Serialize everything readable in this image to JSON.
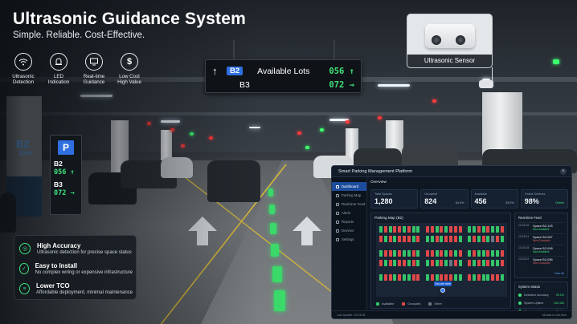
{
  "header": {
    "title": "Ultrasonic Guidance System",
    "subtitle": "Simple. Reliable. Cost-Effective."
  },
  "features": [
    {
      "icon": "wifi-icon",
      "label": "Ultrasonic\nDetection"
    },
    {
      "icon": "bell-icon",
      "label": "LED\nIndication"
    },
    {
      "icon": "monitor-icon",
      "label": "Real-time\nGuidance"
    },
    {
      "icon": "dollar-icon",
      "label": "Low Cost\nHigh Value"
    }
  ],
  "hanging_sign": {
    "row1": {
      "arrow": "↑",
      "badge": "B2",
      "label": "Available Lots",
      "value": "056 ↑"
    },
    "row2": {
      "level": "B3",
      "value": "072 →"
    }
  },
  "sensor": {
    "label": "Ultrasonic Sensor"
  },
  "zone": {
    "code": "B2",
    "sub": "ZONE"
  },
  "pillar_sign": {
    "badge": "P",
    "rows": [
      {
        "level": "B2",
        "value": "056 ↑"
      },
      {
        "level": "B3",
        "value": "072 →"
      }
    ]
  },
  "benefits": [
    {
      "icon": "target-icon",
      "title": "High Accuracy",
      "desc": "Ultrasonic detection for precise space status"
    },
    {
      "icon": "shield-check-icon",
      "title": "Easy to Install",
      "desc": "No complex wiring or expensive infrastructure"
    },
    {
      "icon": "database-icon",
      "title": "Lower TCO",
      "desc": "Affordable deployment, minimal maintenance"
    }
  ],
  "platform": {
    "title": "Smart Parking Management Platform",
    "nav": [
      "Dashboard",
      "Parking Map",
      "Real-time Feed",
      "Alerts",
      "Reports",
      "Devices",
      "Settings"
    ],
    "overview_label": "Overview",
    "cards": [
      {
        "label": "Total Spaces",
        "value": "1,280",
        "pct": ""
      },
      {
        "label": "Occupied",
        "value": "824",
        "pct": "64.4%"
      },
      {
        "label": "Available",
        "value": "456",
        "pct": "35.6%"
      },
      {
        "label": "Online Devices",
        "value": "98%",
        "pct": "Online"
      }
    ],
    "map_title": "Parking Map (B2)",
    "you_are_here": "You are here",
    "legend": [
      "Available",
      "Occupied",
      "Other"
    ],
    "feed_title": "Real-time Feed",
    "feed": [
      {
        "time": "10:24:36",
        "space": "Space B2-125",
        "status": "Now Available",
        "state": "avl"
      },
      {
        "time": "10:24:31",
        "space": "Space B2-087",
        "status": "Now Occupied",
        "state": "occ"
      },
      {
        "time": "10:24:28",
        "space": "Space B2-098",
        "status": "Now Available",
        "state": "avl"
      },
      {
        "time": "10:24:22",
        "space": "Space B2-056",
        "status": "Now Occupied",
        "state": "occ"
      }
    ],
    "view_all": "View All",
    "status_title": "System Status",
    "status": [
      {
        "label": "Detection Accuracy",
        "value": "99.2%"
      },
      {
        "label": "System Uptime",
        "value": "24d 18h"
      },
      {
        "label": "Communication",
        "value": "Stable"
      }
    ],
    "footer_left": "Last Update: 10:24:36",
    "footer_right": "All data is real-time"
  },
  "colors": {
    "accent": "#2f6fe0",
    "available": "#35c46a",
    "occupied": "#e04848",
    "other": "#6b7684"
  }
}
